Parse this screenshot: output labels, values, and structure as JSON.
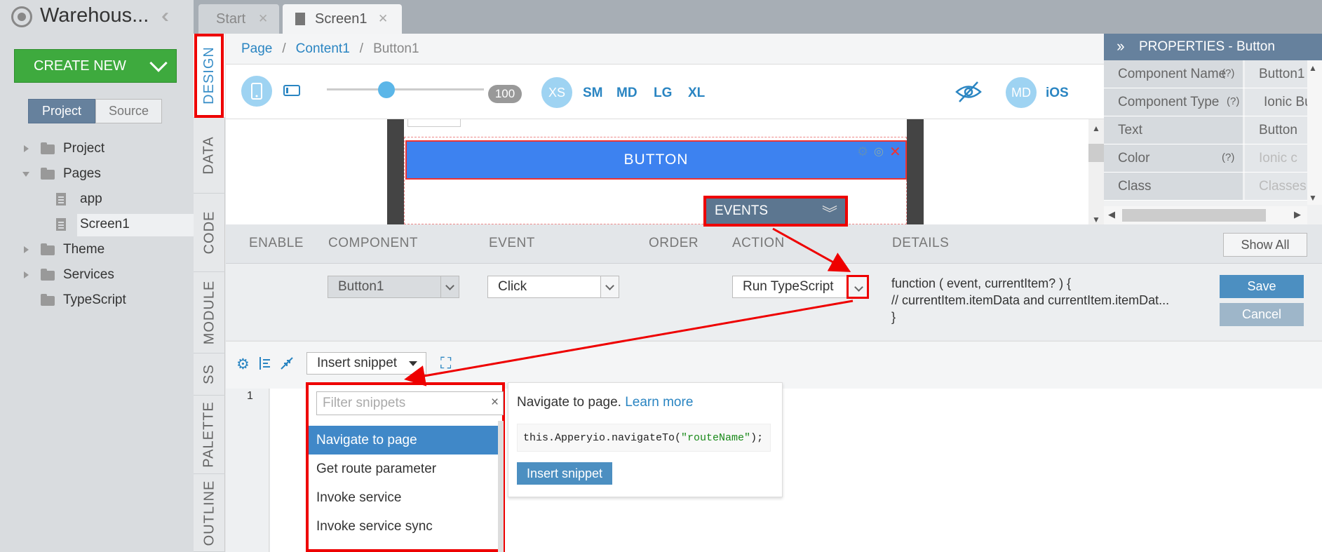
{
  "app": {
    "title": "Warehous...",
    "create_label": "CREATE NEW"
  },
  "left_tabs": {
    "project": "Project",
    "source": "Source"
  },
  "tree": [
    "Project",
    "Pages",
    "app",
    "Screen1",
    "Theme",
    "Services",
    "TypeScript"
  ],
  "tabs": [
    {
      "label": "Start"
    },
    {
      "label": "Screen1"
    }
  ],
  "side_tabs": [
    "DESIGN",
    "DATA",
    "CODE",
    "MODULE",
    "SS",
    "PALETTE",
    "OUTLINE"
  ],
  "breadcrumb": {
    "page": "Page",
    "content": "Content1",
    "current": "Button1"
  },
  "device": {
    "zoom": "100",
    "sizes": [
      "XS",
      "SM",
      "MD",
      "LG",
      "XL"
    ],
    "theme_md": "MD",
    "theme_ios": "iOS"
  },
  "canvas": {
    "button_text": "BUTTON",
    "events_label": "EVENTS"
  },
  "properties": {
    "header": "PROPERTIES - Button",
    "help": "(?)",
    "rows": [
      {
        "key": "Component Name",
        "value": "Button1"
      },
      {
        "key": "Component Type",
        "value": "Ionic Bu"
      },
      {
        "key": "Text",
        "value": "Button"
      },
      {
        "key": "Color",
        "value": "Ionic c"
      },
      {
        "key": "Class",
        "value": "Classes s"
      }
    ]
  },
  "events": {
    "columns": [
      "ENABLE",
      "COMPONENT",
      "EVENT",
      "ORDER",
      "ACTION",
      "DETAILS"
    ],
    "show_all": "Show All",
    "component": "Button1",
    "event": "Click",
    "action": "Run TypeScript",
    "details": [
      "function ( event, currentItem? ) {",
      "// currentItem.itemData and currentItem.itemDat...",
      "}"
    ],
    "save": "Save",
    "cancel": "Cancel"
  },
  "editor": {
    "insert_snippet": "Insert snippet",
    "line_number": "1"
  },
  "snippets": {
    "filter_placeholder": "Filter snippets",
    "clear": "×",
    "items": [
      "Navigate to page",
      "Get route parameter",
      "Invoke service",
      "Invoke service sync"
    ],
    "description": "Navigate to page.",
    "learn_more": "Learn more",
    "code_prefix": "this.Apperyio.navigateTo(",
    "code_arg": "\"routeName\"",
    "code_suffix": ");",
    "insert_button": "Insert snippet"
  },
  "colors": {
    "accent": "#2a85c2",
    "create": "#3eaa3e",
    "highlight": "#ee0000",
    "button": "#3d82f0",
    "header": "#66819d"
  }
}
